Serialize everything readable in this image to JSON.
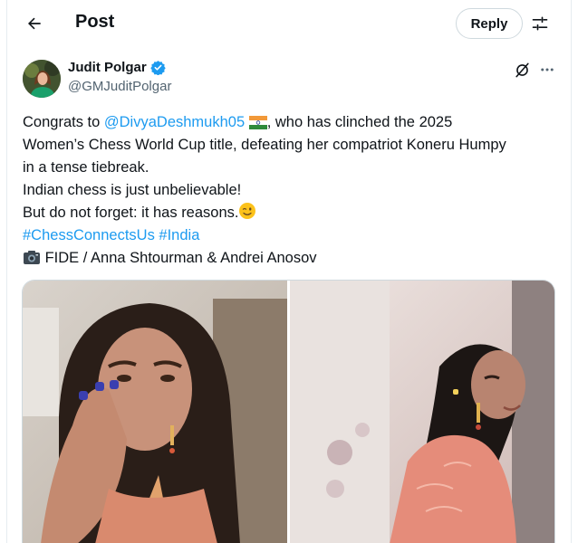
{
  "header": {
    "title": "Post",
    "reply_label": "Reply"
  },
  "icons": {
    "back": "arrow-left-icon",
    "filter": "sliders-icon",
    "verified": "verified-badge-icon",
    "grok": "grok-icon",
    "more": "more-horizontal-icon",
    "flag": "india-flag-icon",
    "wink": "winking-face-icon",
    "camera": "camera-icon"
  },
  "colors": {
    "link": "#1d9bf0",
    "verified": "#1d9bf0",
    "text": "#0f1419",
    "muted": "#536471"
  },
  "author": {
    "name": "Judit Polgar",
    "handle": "@GMJuditPolgar"
  },
  "tweet": {
    "line1_pre": "Congrats to ",
    "mention": "@DivyaDeshmukh05",
    "line1_post": ", who has clinched the 2025",
    "line2": "Women’s Chess World Cup title, defeating her compatriot Koneru Humpy",
    "line3": "in a tense tiebreak.",
    "line4": "Indian chess is just unbelievable!",
    "line5": "But do not forget: it has reasons.",
    "hashtag1": "#ChessConnectsUs",
    "hashtag2": "#India",
    "credit": "FIDE / Anna Shtourman & Andrei Anosov"
  }
}
